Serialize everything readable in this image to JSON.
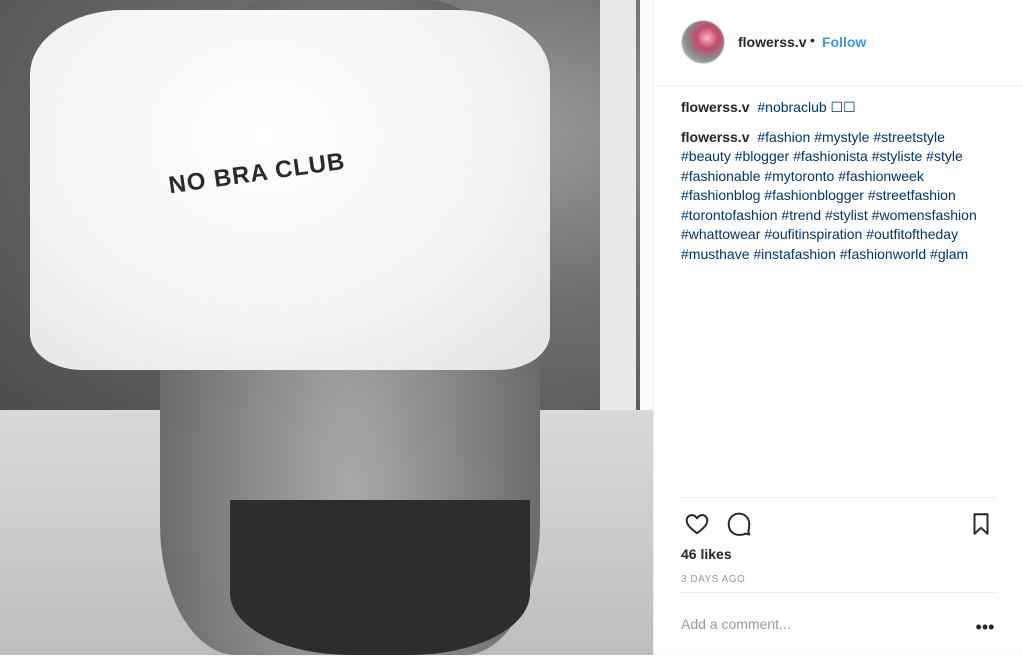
{
  "post": {
    "image": {
      "shirt_text": "NO BRA CLUB"
    },
    "header": {
      "username": "flowerss.v",
      "separator": "•",
      "follow_label": "Follow"
    },
    "comments": [
      {
        "author": "flowerss.v",
        "text": "#nobraclub ☐☐"
      },
      {
        "author": "flowerss.v",
        "text": "#fashion #mystyle #streetstyle #beauty #blogger #fashionista #styliste #style #fashionable #mytoronto #fashionweek #fashionblog #fashionblogger #streetfashion #torontofashion #trend #stylist #womensfashion #whattowear #oufitinspiration #outfitoftheday #musthave #instafashion #fashionworld #glam"
      }
    ],
    "actions": {
      "like_icon": "heart-outline-icon",
      "comment_icon": "comment-bubble-icon",
      "save_icon": "bookmark-outline-icon"
    },
    "likes_text": "46 likes",
    "timestamp": "3 DAYS AGO",
    "add_comment": {
      "placeholder": "Add a comment...",
      "more_label": "•••"
    },
    "colors": {
      "follow": "#3897f0",
      "hashtag": "#003569",
      "muted": "#999999",
      "divider": "#efefef"
    }
  }
}
